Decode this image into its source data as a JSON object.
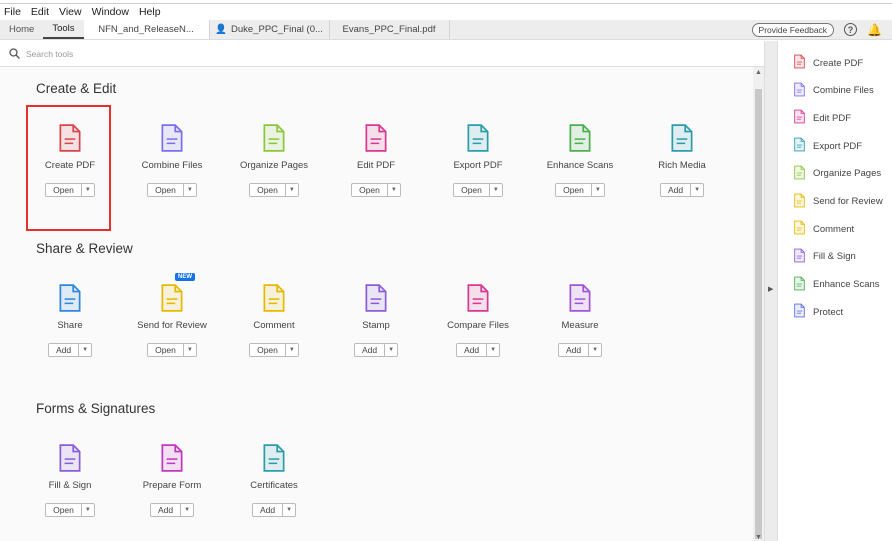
{
  "menu": [
    "File",
    "Edit",
    "View",
    "Window",
    "Help"
  ],
  "nav_tabs": [
    {
      "label": "Home",
      "active": false
    },
    {
      "label": "Tools",
      "active": true
    }
  ],
  "doc_tabs": [
    "NFN_and_ReleaseN...",
    "Duke_PPC_Final (0...",
    "Evans_PPC_Final.pdf"
  ],
  "feedback_label": "Provide Feedback",
  "search_placeholder": "Search tools",
  "new_badge": "NEW",
  "sections": [
    {
      "title": "Create & Edit",
      "tools": [
        {
          "label": "Create PDF",
          "button": "Open",
          "color": "#d9444b",
          "icon": "create-pdf-icon",
          "selected": true
        },
        {
          "label": "Combine Files",
          "button": "Open",
          "color": "#7b6ef0",
          "icon": "combine-files-icon"
        },
        {
          "label": "Organize Pages",
          "button": "Open",
          "color": "#8cc63f",
          "icon": "organize-pages-icon"
        },
        {
          "label": "Edit PDF",
          "button": "Open",
          "color": "#d8388f",
          "icon": "edit-pdf-icon"
        },
        {
          "label": "Export PDF",
          "button": "Open",
          "color": "#2d9caa",
          "icon": "export-pdf-icon"
        },
        {
          "label": "Enhance Scans",
          "button": "Open",
          "color": "#4caf50",
          "icon": "enhance-scans-icon"
        },
        {
          "label": "Rich Media",
          "button": "Add",
          "color": "#2d9caa",
          "icon": "rich-media-icon"
        }
      ]
    },
    {
      "title": "Share & Review",
      "tools": [
        {
          "label": "Share",
          "button": "Add",
          "color": "#2e86de",
          "icon": "share-icon"
        },
        {
          "label": "Send for Review",
          "button": "Open",
          "color": "#e4b900",
          "icon": "send-for-review-icon"
        },
        {
          "label": "Comment",
          "button": "Open",
          "color": "#e4b900",
          "icon": "comment-icon"
        },
        {
          "label": "Stamp",
          "button": "Add",
          "color": "#8a5dd8",
          "icon": "stamp-icon"
        },
        {
          "label": "Compare Files",
          "button": "Add",
          "color": "#d8388f",
          "icon": "compare-files-icon"
        },
        {
          "label": "Measure",
          "button": "Add",
          "color": "#a155d6",
          "icon": "measure-icon"
        }
      ]
    },
    {
      "title": "Forms & Signatures",
      "tools": [
        {
          "label": "Fill & Sign",
          "button": "Open",
          "color": "#8a5dd8",
          "icon": "fill-sign-icon"
        },
        {
          "label": "Prepare Form",
          "button": "Add",
          "color": "#c036c0",
          "icon": "prepare-form-icon"
        },
        {
          "label": "Certificates",
          "button": "Add",
          "color": "#2d9caa",
          "icon": "certificates-icon"
        }
      ]
    }
  ],
  "right_panel": [
    {
      "label": "Create PDF",
      "color": "#d9444b"
    },
    {
      "label": "Combine Files",
      "color": "#7b6ef0"
    },
    {
      "label": "Edit PDF",
      "color": "#d8388f"
    },
    {
      "label": "Export PDF",
      "color": "#2d9caa"
    },
    {
      "label": "Organize Pages",
      "color": "#8cc63f"
    },
    {
      "label": "Send for Review",
      "color": "#e4b900"
    },
    {
      "label": "Comment",
      "color": "#e4b900"
    },
    {
      "label": "Fill & Sign",
      "color": "#8a5dd8"
    },
    {
      "label": "Enhance Scans",
      "color": "#4caf50"
    },
    {
      "label": "Protect",
      "color": "#5b6ee0"
    }
  ]
}
